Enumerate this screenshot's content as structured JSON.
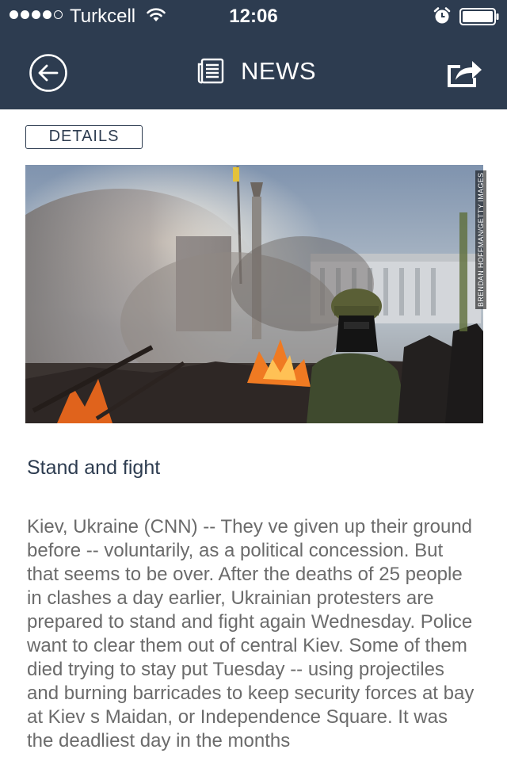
{
  "status_bar": {
    "carrier": "Turkcell",
    "time": "12:06",
    "icons": [
      "signal-dots-icon",
      "wifi-icon",
      "alarm-icon",
      "battery-icon"
    ]
  },
  "nav": {
    "title": "NEWS",
    "back_icon": "circle-arrow-left-icon",
    "title_icon": "newspaper-icon",
    "share_icon": "share-icon"
  },
  "article": {
    "details_label": "DETAILS",
    "photo_credit": "BRENDAN HOFFMAN/GETTY IMAGES",
    "headline": "Stand and fight",
    "body": "Kiev, Ukraine (CNN) -- They ve given up their ground before -- voluntarily, as a political concession. But that seems to be over. After the deaths of 25 people in clashes a day earlier, Ukrainian protesters are prepared to stand and fight again Wednesday. Police want to clear them out of central Kiev. Some of them died trying to stay put Tuesday -- using projectiles and burning barricades to keep security forces at bay at Kiev s Maidan, or Independence Square. It was the deadliest day in the months"
  },
  "colors": {
    "bar": "#2d3c50",
    "headline": "#2d3c50",
    "body_text": "#6b6b6b"
  }
}
